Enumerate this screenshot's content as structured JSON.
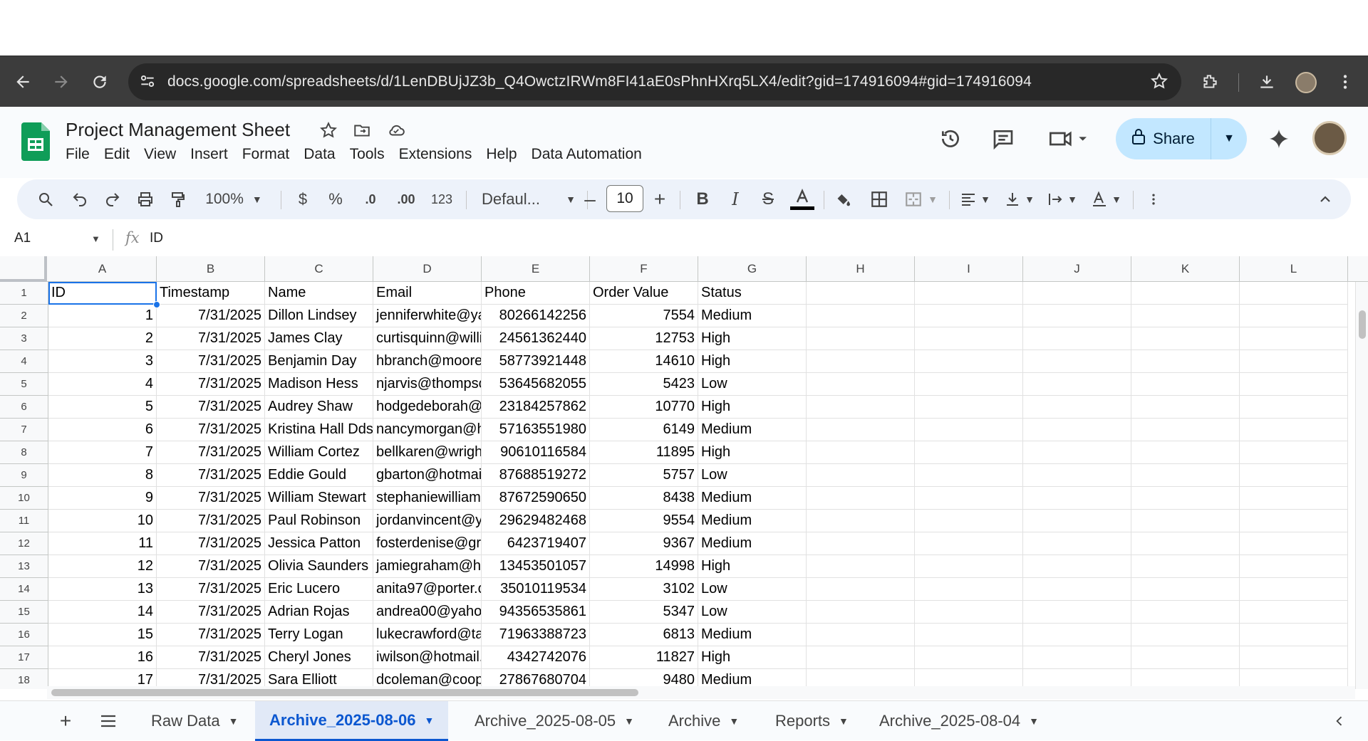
{
  "browser": {
    "url": "docs.google.com/spreadsheets/d/1LenDBUjJZ3b_Q4OwctzIRWm8FI41aE0sPhnHXrq5LX4/edit?gid=174916094#gid=174916094"
  },
  "doc": {
    "title": "Project Management Sheet",
    "menu": [
      "File",
      "Edit",
      "View",
      "Insert",
      "Format",
      "Data",
      "Tools",
      "Extensions",
      "Help",
      "Data Automation"
    ],
    "share_label": "Share"
  },
  "toolbar": {
    "zoom": "100%",
    "currency": "$",
    "percent": "%",
    "dec_decrease": ".0",
    "dec_increase": ".00",
    "number_format": "123",
    "font": "Defaul...",
    "font_size": "10"
  },
  "formula": {
    "name_box": "A1",
    "fx": "fx",
    "value": "ID"
  },
  "grid": {
    "columns": [
      "A",
      "B",
      "C",
      "D",
      "E",
      "F",
      "G",
      "H",
      "I",
      "J",
      "K",
      "L"
    ],
    "rows": [
      {
        "n": "1",
        "cells": [
          "ID",
          "Timestamp",
          "Name",
          "Email",
          "Phone",
          "Order Value",
          "Status"
        ]
      },
      {
        "n": "2",
        "cells": [
          "1",
          "7/31/2025",
          "Dillon Lindsey",
          "jenniferwhite@ya",
          "80266142256",
          "7554",
          "Medium"
        ]
      },
      {
        "n": "3",
        "cells": [
          "2",
          "7/31/2025",
          "James Clay",
          "curtisquinn@willi",
          "24561362440",
          "12753",
          "High"
        ]
      },
      {
        "n": "4",
        "cells": [
          "3",
          "7/31/2025",
          "Benjamin Day",
          "hbranch@moore",
          "58773921448",
          "14610",
          "High"
        ]
      },
      {
        "n": "5",
        "cells": [
          "4",
          "7/31/2025",
          "Madison Hess",
          "njarvis@thompsc",
          "53645682055",
          "5423",
          "Low"
        ]
      },
      {
        "n": "6",
        "cells": [
          "5",
          "7/31/2025",
          "Audrey Shaw",
          "hodgedeborah@",
          "23184257862",
          "10770",
          "High"
        ]
      },
      {
        "n": "7",
        "cells": [
          "6",
          "7/31/2025",
          "Kristina Hall Dds",
          "nancymorgan@h",
          "57163551980",
          "6149",
          "Medium"
        ]
      },
      {
        "n": "8",
        "cells": [
          "7",
          "7/31/2025",
          "William Cortez",
          "bellkaren@wrigh",
          "90610116584",
          "11895",
          "High"
        ]
      },
      {
        "n": "9",
        "cells": [
          "8",
          "7/31/2025",
          "Eddie Gould",
          "gbarton@hotmai",
          "87688519272",
          "5757",
          "Low"
        ]
      },
      {
        "n": "10",
        "cells": [
          "9",
          "7/31/2025",
          "William Stewart",
          "stephaniewilliam",
          "87672590650",
          "8438",
          "Medium"
        ]
      },
      {
        "n": "11",
        "cells": [
          "10",
          "7/31/2025",
          "Paul Robinson",
          "jordanvincent@y",
          "29629482468",
          "9554",
          "Medium"
        ]
      },
      {
        "n": "12",
        "cells": [
          "11",
          "7/31/2025",
          "Jessica Patton",
          "fosterdenise@gr",
          "6423719407",
          "9367",
          "Medium"
        ]
      },
      {
        "n": "13",
        "cells": [
          "12",
          "7/31/2025",
          "Olivia Saunders",
          "jamiegraham@h",
          "13453501057",
          "14998",
          "High"
        ]
      },
      {
        "n": "14",
        "cells": [
          "13",
          "7/31/2025",
          "Eric Lucero",
          "anita97@porter.c",
          "35010119534",
          "3102",
          "Low"
        ]
      },
      {
        "n": "15",
        "cells": [
          "14",
          "7/31/2025",
          "Adrian Rojas",
          "andrea00@yaho",
          "94356535861",
          "5347",
          "Low"
        ]
      },
      {
        "n": "16",
        "cells": [
          "15",
          "7/31/2025",
          "Terry Logan",
          "lukecrawford@ta",
          "71963388723",
          "6813",
          "Medium"
        ]
      },
      {
        "n": "17",
        "cells": [
          "16",
          "7/31/2025",
          "Cheryl Jones",
          "iwilson@hotmail.",
          "4342742076",
          "11827",
          "High"
        ]
      },
      {
        "n": "18",
        "cells": [
          "17",
          "7/31/2025",
          "Sara Elliott",
          "dcoleman@coop",
          "27867680704",
          "9480",
          "Medium"
        ]
      }
    ]
  },
  "tabs": {
    "items": [
      {
        "label": "Raw Data",
        "active": false
      },
      {
        "label": "Archive_2025-08-06",
        "active": true
      },
      {
        "label": "Archive_2025-08-05",
        "active": false
      },
      {
        "label": "Archive",
        "active": false
      },
      {
        "label": "Reports",
        "active": false
      },
      {
        "label": "Archive_2025-08-04",
        "active": false
      }
    ]
  },
  "colors": {
    "accent": "#1a73e8",
    "share_bg": "#c2e7ff",
    "sheets_green": "#0f9d58"
  }
}
